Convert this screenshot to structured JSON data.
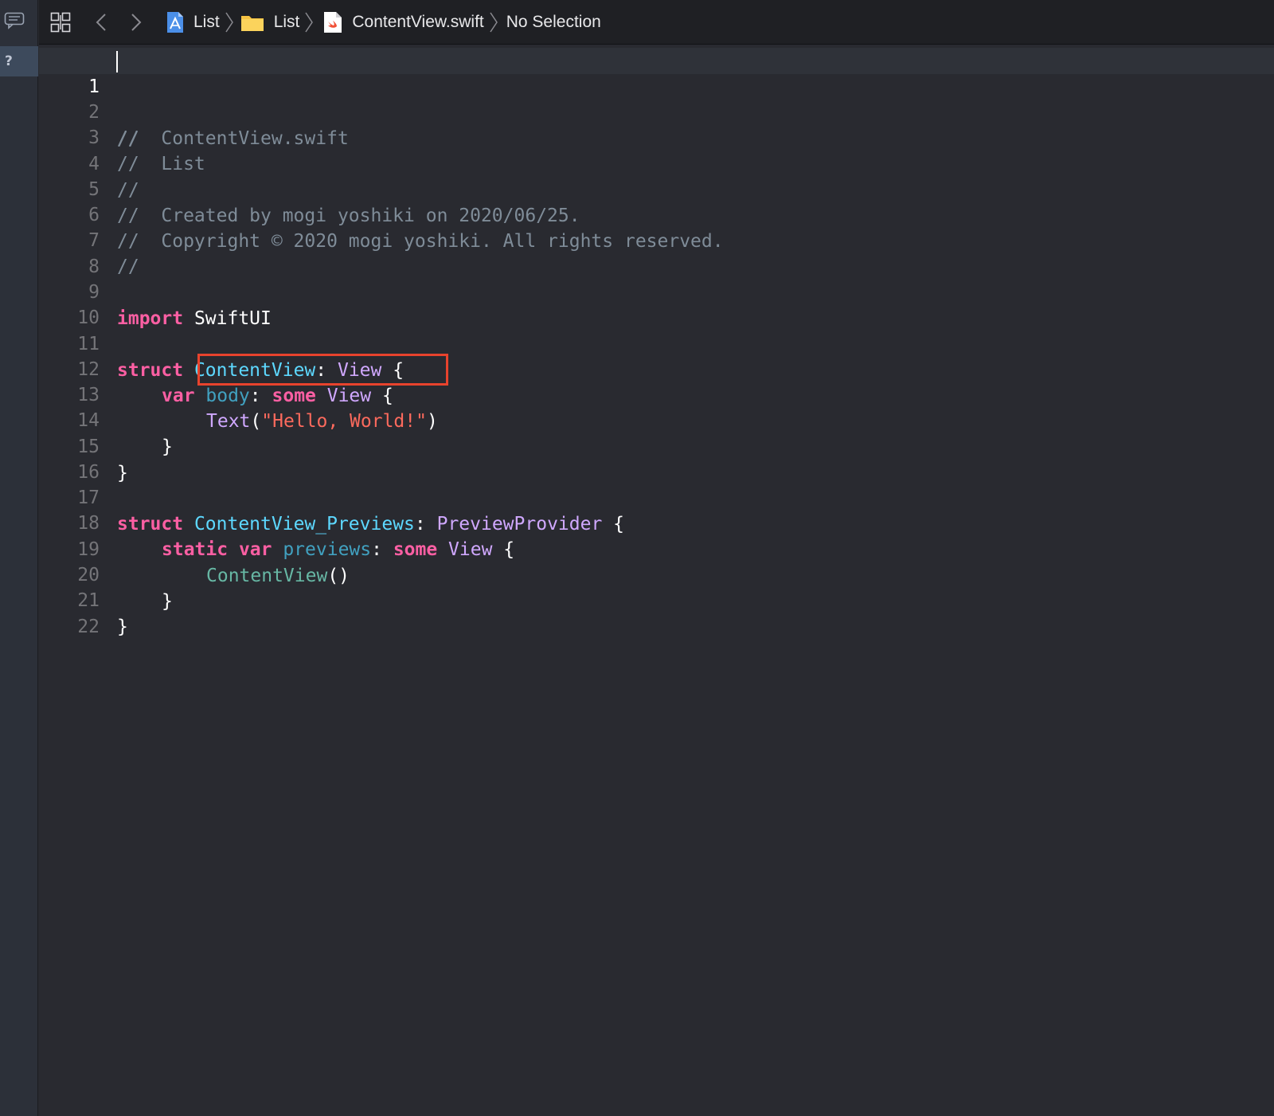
{
  "jumpbar": {
    "crumbs": [
      "List",
      "List",
      "ContentView.swift",
      "No Selection"
    ]
  },
  "sidebar": {
    "help_label": "?"
  },
  "editor": {
    "line_numbers": [
      "1",
      "2",
      "3",
      "4",
      "5",
      "6",
      "7",
      "8",
      "9",
      "10",
      "11",
      "12",
      "13",
      "14",
      "15",
      "16",
      "17",
      "18",
      "19",
      "20",
      "21",
      "22"
    ],
    "lines": {
      "l1": "//",
      "l2": "//  ContentView.swift",
      "l3": "//  List",
      "l4": "//",
      "l5": "//  Created by mogi yoshiki on 2020/06/25.",
      "l6": "//  Copyright © 2020 mogi yoshiki. All rights reserved.",
      "l7": "//",
      "l9_kw": "import",
      "l9_mod": " SwiftUI",
      "l11_kw": "struct",
      "l11_name": " ContentView",
      "l11_colon": ": ",
      "l11_type": "View",
      "l11_brace": " {",
      "l12_kw": "var",
      "l12_name": " body",
      "l12_colon": ": ",
      "l12_kw2": "some",
      "l12_type": " View",
      "l12_brace": " {",
      "l13_func": "Text",
      "l13_open": "(",
      "l13_string": "\"Hello, World!\"",
      "l13_close": ")",
      "l14": "}",
      "l15": "}",
      "l17_kw": "struct",
      "l17_name": " ContentView_Previews",
      "l17_colon": ": ",
      "l17_type": "PreviewProvider",
      "l17_brace": " {",
      "l18_kw": "static",
      "l18_kw2": " var",
      "l18_name": " previews",
      "l18_colon": ": ",
      "l18_kw3": "some",
      "l18_type": " View",
      "l18_brace": " {",
      "l19_func": "ContentView",
      "l19_call": "()",
      "l20": "}",
      "l21": "}"
    }
  },
  "colors": {
    "background": "#292a30",
    "comment": "#7f8c98",
    "keyword": "#fc5fa3",
    "type_declaration": "#5dd8ff",
    "type": "#d0a8ff",
    "string": "#fc6a5d",
    "highlight_box": "#e8432d"
  }
}
